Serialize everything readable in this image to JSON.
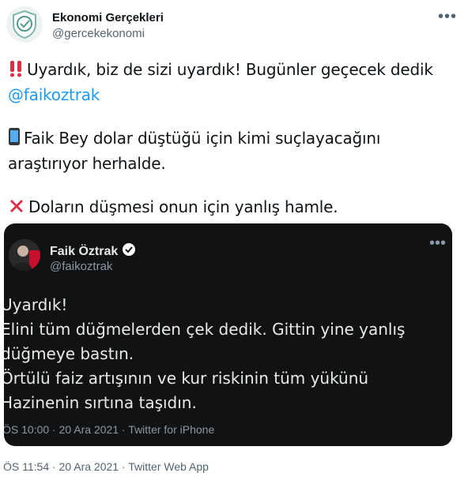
{
  "author": {
    "name": "Ekonomi Gerçekleri",
    "handle": "@gercekekonomi"
  },
  "tweet": {
    "line1_text": "Uyardık, biz de sizi uyardık! Bugünler geçecek dedik",
    "mention": "@faikoztrak",
    "line2_text": "Faik Bey dolar düştüğü için kimi suçlayacağını araştırıyor herhalde.",
    "line3_text": "Doların düşmesi onun için yanlış hamle.",
    "emoji1": "double-exclamation-icon",
    "emoji2": "mobile-phone-icon",
    "emoji3": "red-cross-icon"
  },
  "quoted": {
    "name": "Faik Öztrak",
    "handle": "@faikoztrak",
    "lines": [
      "Uyardık!",
      "Elini tüm düğmelerden çek dedik. Gittin yine yanlış",
      "düğmeye bastın.",
      "Örtülü faiz artışının ve kur riskinin tüm yükünü",
      "Hazinenin sırtına taşıdın."
    ],
    "meta": "ÖS 10:00 · 20 Ara 2021 · Twitter for iPhone"
  },
  "meta": "ÖS 11:54 · 20 Ara 2021 · Twitter Web App",
  "colors": {
    "link": "#1d9bf0",
    "quote_bg": "#101214",
    "verified": "#ffffff"
  }
}
